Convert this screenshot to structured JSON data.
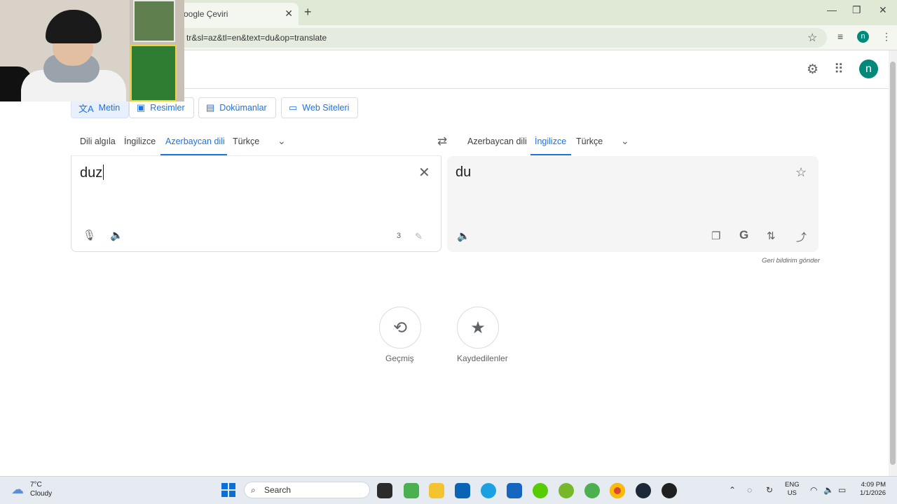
{
  "browser": {
    "tab_title": "oogle Çeviri",
    "tab_close": "✕",
    "new_tab": "+",
    "url": "tr&sl=az&tl=en&text=du&op=translate",
    "profile_initial": "n",
    "window_controls": {
      "minimize": "—",
      "restore": "❐",
      "close": "✕"
    }
  },
  "header": {
    "profile_initial": "n"
  },
  "modes": [
    {
      "label": "Metin",
      "icon": "translate-icon"
    },
    {
      "label": "Resimler",
      "icon": "image-icon"
    },
    {
      "label": "Dokümanlar",
      "icon": "document-icon"
    },
    {
      "label": "Web Siteleri",
      "icon": "website-icon"
    }
  ],
  "source_langs": [
    "Dili algıla",
    "İngilizce",
    "Azerbaycan dili",
    "Türkçe"
  ],
  "target_langs": [
    "Azerbaycan dili",
    "İngilizce",
    "Türkçe"
  ],
  "source": {
    "text": "duz",
    "char_count": "3"
  },
  "target": {
    "text": "du"
  },
  "feedback": "Geri bildirim gönder",
  "bottom": {
    "history_label": "Geçmiş",
    "saved_label": "Kaydedilenler"
  },
  "taskbar": {
    "temperature": "7°C",
    "weather": "Cloudy",
    "search_placeholder": "Search",
    "lang_line1": "ENG",
    "lang_line2": "US",
    "time": "4:09 PM",
    "date": "1/1/2026"
  },
  "colors": {
    "accent": "#1a73e8",
    "avatar": "#00897b",
    "target_bg": "#f5f5f5"
  }
}
